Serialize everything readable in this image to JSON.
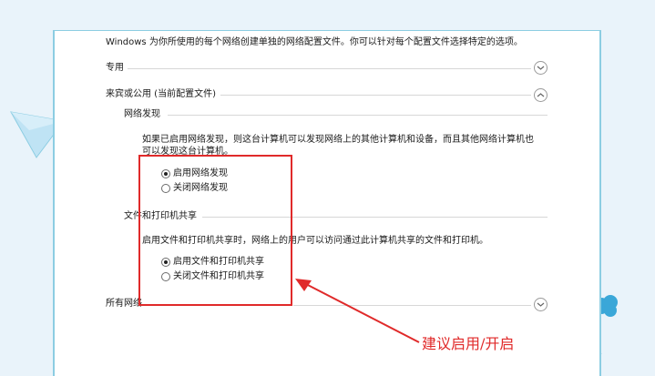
{
  "intro": "Windows 为你所使用的每个网络创建单独的网络配置文件。你可以针对每个配置文件选择特定的选项。",
  "sections": {
    "private": "专用",
    "guest_public": "来宾或公用 (当前配置文件)",
    "all_networks": "所有网络"
  },
  "network_discovery": {
    "heading": "网络发现",
    "description_line1": "如果已启用网络发现，则这台计算机可以发现网络上的其他计算机和设备，而且其他网络计算机也",
    "description_line2": "可以发现这台计算机。",
    "options": [
      {
        "label": "启用网络发现",
        "checked": true
      },
      {
        "label": "关闭网络发现",
        "checked": false
      }
    ]
  },
  "file_printer_sharing": {
    "heading": "文件和打印机共享",
    "description": "启用文件和打印机共享时，网络上的用户可以访问通过此计算机共享的文件和打印机。",
    "options": [
      {
        "label": "启用文件和打印机共享",
        "checked": true
      },
      {
        "label": "关闭文件和打印机共享",
        "checked": false
      }
    ]
  },
  "annotation": {
    "text": "建议启用/开启",
    "color": "#e02a2a"
  },
  "colors": {
    "background": "#e9f3fa",
    "panel_border": "#8ccde2",
    "highlight": "#e02a2a"
  },
  "icons": {
    "collapsed": "chevron-down-icon",
    "expanded": "chevron-up-icon"
  }
}
